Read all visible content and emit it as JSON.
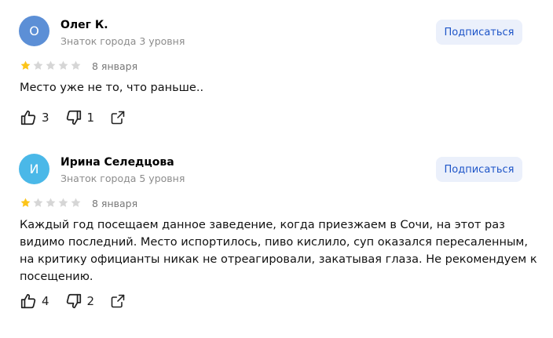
{
  "reviews": [
    {
      "avatar_letter": "О",
      "avatar_color": "#5c8fd6",
      "name": "Олег К.",
      "level": "Знаток города 3 уровня",
      "subscribe_label": "Подписаться",
      "rating": 1,
      "max_rating": 5,
      "date": "8 января",
      "text_lines": [
        "Место уже не то, что раньше.."
      ],
      "likes": "3",
      "dislikes": "1",
      "share_icon": "share-icon"
    },
    {
      "avatar_letter": "И",
      "avatar_color": "#4ab8e8",
      "name": "Ирина Селедцова",
      "level": "Знаток города 5 уровня",
      "subscribe_label": "Подписаться",
      "rating": 1,
      "max_rating": 5,
      "date": "8 января",
      "text_lines": [
        "Каждый год посещаем данное заведение, когда приезжаем в Сочи, на этот раз",
        "видимо последний. Место испортилось, пиво кислило, суп оказался пересаленным,",
        "на критику официанты никак не отреагировали, закатывая глаза. Не рекомендуем к",
        "посещению."
      ],
      "likes": "4",
      "dislikes": "2",
      "share_icon": "share-icon"
    }
  ],
  "colors": {
    "star_filled": "#fcc419",
    "star_empty": "#d6d6d6",
    "subscribe_bg": "#ebf0fb",
    "subscribe_text": "#1e55c8"
  }
}
